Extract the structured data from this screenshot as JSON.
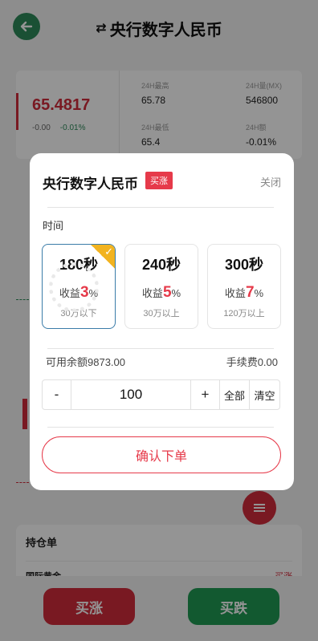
{
  "header": {
    "title": "央行数字人民币"
  },
  "stats": {
    "price": "65.4817",
    "change": "-0.00",
    "change_pct": "-0.01%",
    "high_label": "24H最高",
    "high": "65.78",
    "vol_label": "24H量(MX)",
    "vol": "546800",
    "low_label": "24H最低",
    "low": "65.4",
    "amt_label": "24H额",
    "amt": "-0.01%"
  },
  "positions": {
    "title": "持仓单",
    "row_name": "国际黄金",
    "row_side": "买涨"
  },
  "actions": {
    "buy_up": "买涨",
    "buy_down": "买跌"
  },
  "modal": {
    "title": "央行数字人民币",
    "badge": "买涨",
    "close": "关闭",
    "time_label": "时间",
    "options": [
      {
        "seconds": "180秒",
        "income_prefix": "收益",
        "income": "3",
        "income_suffix": "%",
        "range": "30万以下",
        "selected": true
      },
      {
        "seconds": "240秒",
        "income_prefix": "收益",
        "income": "5",
        "income_suffix": "%",
        "range": "30万以上",
        "selected": false
      },
      {
        "seconds": "300秒",
        "income_prefix": "收益",
        "income": "7",
        "income_suffix": "%",
        "range": "120万以上",
        "selected": false
      }
    ],
    "available": "可用余额9873.00",
    "fee": "手续费0.00",
    "stepper": {
      "minus": "-",
      "value": "100",
      "plus": "+",
      "all": "全部",
      "clear": "清空"
    },
    "confirm": "确认下单"
  },
  "colors": {
    "accent_red": "#e63a4a",
    "accent_green": "#1f9a54",
    "selected_border": "#3a7ca8",
    "corner_badge": "#f2b31f"
  }
}
